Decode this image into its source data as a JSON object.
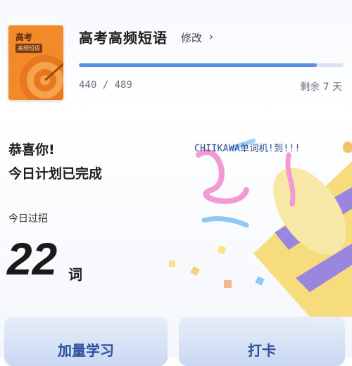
{
  "header": {
    "book_cover_title": "高考",
    "book_cover_subtitle": "高频短语",
    "book_name": "高考高频短语",
    "modify_label": "修改",
    "chevron": "›",
    "progress_text": "440 / 489",
    "progress_fraction": 0.8998,
    "remaining_text": "剩余 7 天"
  },
  "main": {
    "congrats": "恭喜你!",
    "plan_done": "今日计划已完成",
    "banner_text": "CHIIKAWA单词机!到!!!",
    "today_label": "今日过招",
    "word_count": "22",
    "word_unit": "词"
  },
  "actions": {
    "add_study": "加量学习",
    "check_in": "打卡"
  },
  "colors": {
    "accent": "#5b8fe1",
    "book_cover": "#f28a2a",
    "button_text": "#2b4f9c"
  }
}
